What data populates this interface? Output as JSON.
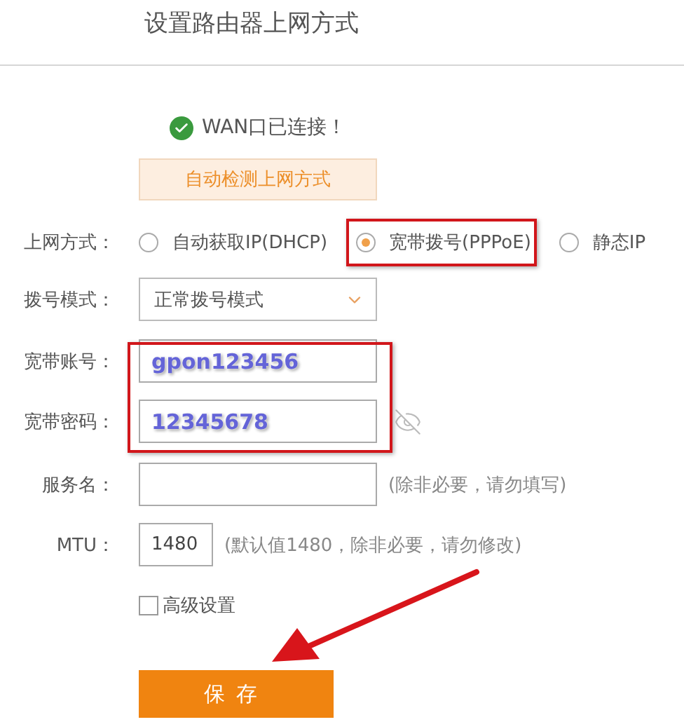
{
  "title": "设置路由器上网方式",
  "status": {
    "text": "WAN口已连接！",
    "connected": true
  },
  "detect_button": "自动检测上网方式",
  "connection_type": {
    "label": "上网方式：",
    "options": [
      {
        "label": "自动获取IP(DHCP)",
        "selected": false,
        "highlighted": false
      },
      {
        "label": "宽带拨号(PPPoE)",
        "selected": true,
        "highlighted": true
      },
      {
        "label": "静态IP",
        "selected": false,
        "highlighted": false
      }
    ]
  },
  "dial_mode": {
    "label": "拨号模式：",
    "value": "正常拨号模式"
  },
  "credentials": {
    "highlighted": true,
    "account": {
      "label": "宽带账号：",
      "value": "gpon123456"
    },
    "password": {
      "label": "宽带密码：",
      "value": "12345678"
    }
  },
  "service_name": {
    "label": "服务名：",
    "hint": "(除非必要，请勿填写)"
  },
  "mtu": {
    "label": "MTU：",
    "value": "1480",
    "hint": "(默认值1480，除非必要，请勿修改)"
  },
  "advanced": {
    "label": "高级设置",
    "checked": false
  },
  "save_button": "保存",
  "arrow_to_save": true
}
